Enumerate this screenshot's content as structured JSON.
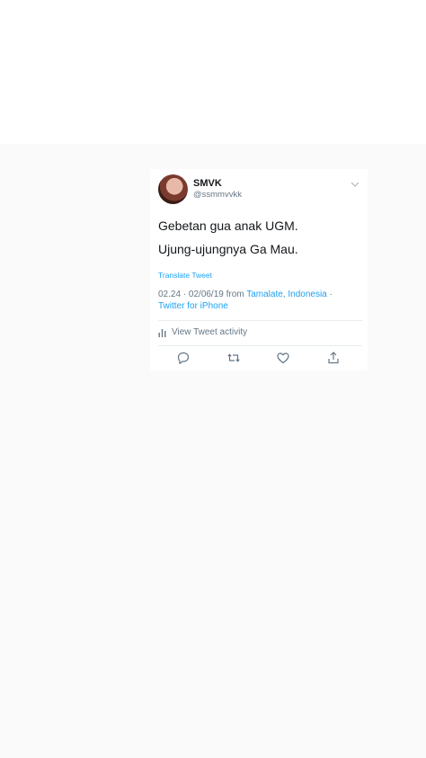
{
  "tweet": {
    "display_name": "SMVK",
    "handle": "@ssmmvvkk",
    "line1": "Gebetan gua anak UGM.",
    "line2": "Ujung-ujungnya Ga Mau.",
    "translate_label": "Translate Tweet",
    "time_date": "02.24 · 02/06/19 from ",
    "location": "Tamalate, Indonesia",
    "separator": " ·",
    "source": "Twitter for iPhone",
    "activity_label": "View Tweet activity"
  },
  "icons": {
    "caret": "chevron-down-icon",
    "activity": "bar-chart-icon",
    "reply": "reply-icon",
    "retweet": "retweet-icon",
    "like": "heart-icon",
    "share": "share-icon"
  },
  "colors": {
    "link": "#1da1f2",
    "muted": "#657786",
    "text": "#14171a",
    "divider": "#e6ecf0",
    "backdrop": "#fafafa"
  }
}
